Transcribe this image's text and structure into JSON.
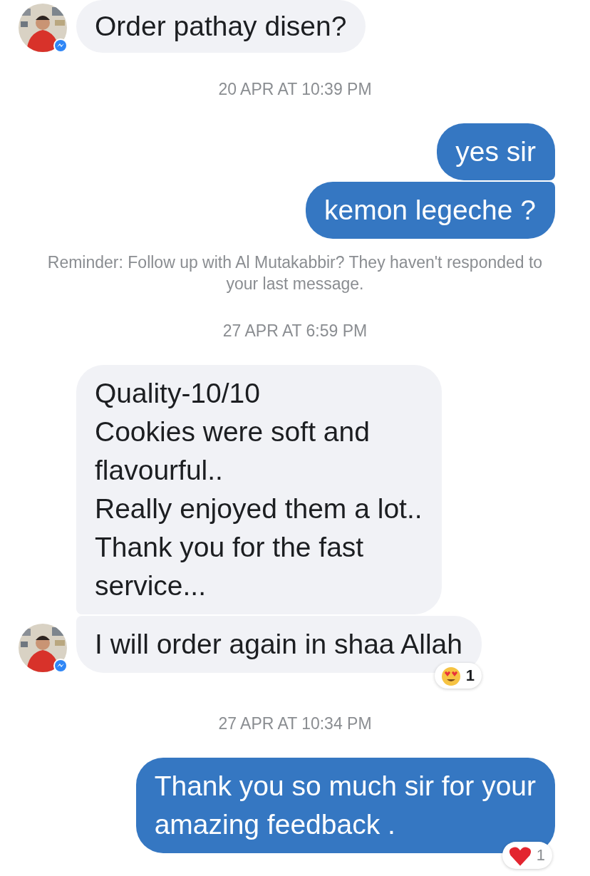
{
  "messages": [
    {
      "kind": "incoming",
      "lines": [
        "Order pathay disen?"
      ],
      "avatar": true
    },
    {
      "kind": "timestamp",
      "text": "20 APR AT 10:39 PM"
    },
    {
      "kind": "outgoing",
      "lines": [
        "yes sir"
      ]
    },
    {
      "kind": "outgoing",
      "lines": [
        "kemon legeche ?"
      ]
    },
    {
      "kind": "reminder",
      "text": "Reminder: Follow up with Al Mutakabbir? They haven't responded to your last message."
    },
    {
      "kind": "timestamp",
      "text": "27 APR AT 6:59 PM"
    },
    {
      "kind": "incoming",
      "lines": [
        "Quality-10/10",
        "Cookies were soft and",
        "flavourful..",
        "Really enjoyed them a lot..",
        "Thank you for the fast",
        "service..."
      ],
      "avatar": false
    },
    {
      "kind": "incoming",
      "lines": [
        "I will order again in shaa Allah"
      ],
      "avatar": true,
      "reaction": {
        "kind": "heart-eyes",
        "count": "1"
      }
    },
    {
      "kind": "timestamp",
      "text": "27 APR AT 10:34 PM"
    },
    {
      "kind": "outgoing",
      "lines": [
        "Thank you so much sir for your",
        "amazing feedback ."
      ],
      "reaction": {
        "kind": "heart",
        "count": "1"
      }
    }
  ]
}
